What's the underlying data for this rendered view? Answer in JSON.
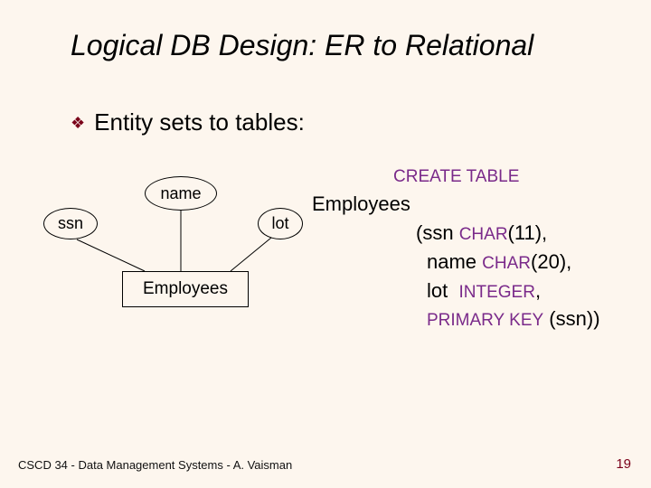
{
  "title": "Logical DB Design: ER to Relational",
  "bullet": {
    "icon": "❖",
    "text": "Entity sets to tables:"
  },
  "er": {
    "attrs": {
      "ssn": "ssn",
      "name": "name",
      "lot": "lot"
    },
    "entity": "Employees"
  },
  "sql": {
    "create_table_kw": "CREATE TABLE",
    "table_name": "Employees",
    "cols": {
      "ssn": {
        "name": "ssn",
        "open": "(",
        "type_kw": "CHAR",
        "args": "(11),",
        "trail": ""
      },
      "name": {
        "name": "name",
        "open": "",
        "type_kw": "CHAR",
        "args": "(20),",
        "trail": ""
      },
      "lot": {
        "name": "lot",
        "open": "",
        "type_kw": "INTEGER",
        "args": ",",
        "trail": ""
      }
    },
    "pk": {
      "kw": "PRIMARY KEY",
      "args": " (ssn))"
    }
  },
  "footer": "CSCD 34 - Data Management Systems - A. Vaisman",
  "page_number": "19"
}
